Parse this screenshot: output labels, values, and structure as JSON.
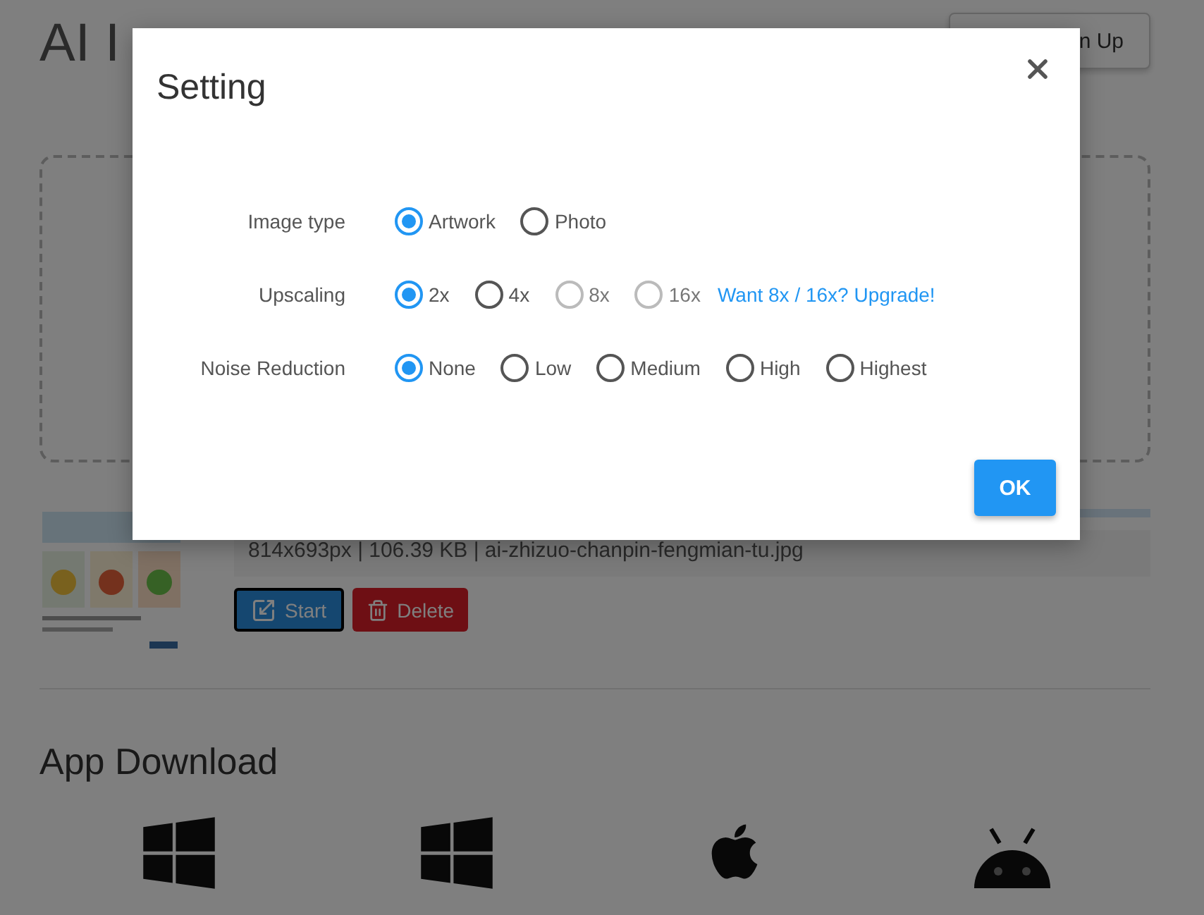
{
  "header": {
    "title": "AI I",
    "signup": "n Up"
  },
  "file": {
    "progress": {
      "level": 1
    },
    "info": "814x693px | 106.39 KB | ai-zhizuo-chanpin-fengmian-tu.jpg",
    "buttons": [
      {
        "kind": "start",
        "label": "Start"
      },
      {
        "kind": "delete",
        "label": "Delete"
      }
    ]
  },
  "downloads": {
    "heading": "App Download",
    "platforms": [
      {
        "kind": "windows"
      },
      {
        "kind": "windows"
      },
      {
        "kind": "apple"
      },
      {
        "kind": "android"
      }
    ]
  },
  "dialog": {
    "title": "Setting",
    "rows": [
      {
        "label": "Image type",
        "options": [
          {
            "label": "Artwork",
            "selected": true,
            "disabled": false
          },
          {
            "label": "Photo",
            "selected": false,
            "disabled": false
          }
        ]
      },
      {
        "label": "Upscaling",
        "options": [
          {
            "label": "2x",
            "selected": true,
            "disabled": false
          },
          {
            "label": "4x",
            "selected": false,
            "disabled": false
          },
          {
            "label": "8x",
            "selected": false,
            "disabled": true
          },
          {
            "label": "16x",
            "selected": false,
            "disabled": true
          }
        ],
        "link": "Want 8x / 16x? Upgrade!"
      },
      {
        "label": "Noise Reduction",
        "options": [
          {
            "label": "None",
            "selected": true,
            "disabled": false
          },
          {
            "label": "Low",
            "selected": false,
            "disabled": false
          },
          {
            "label": "Medium",
            "selected": false,
            "disabled": false
          },
          {
            "label": "High",
            "selected": false,
            "disabled": false
          },
          {
            "label": "Highest",
            "selected": false,
            "disabled": false
          }
        ]
      }
    ],
    "ok": "OK"
  }
}
